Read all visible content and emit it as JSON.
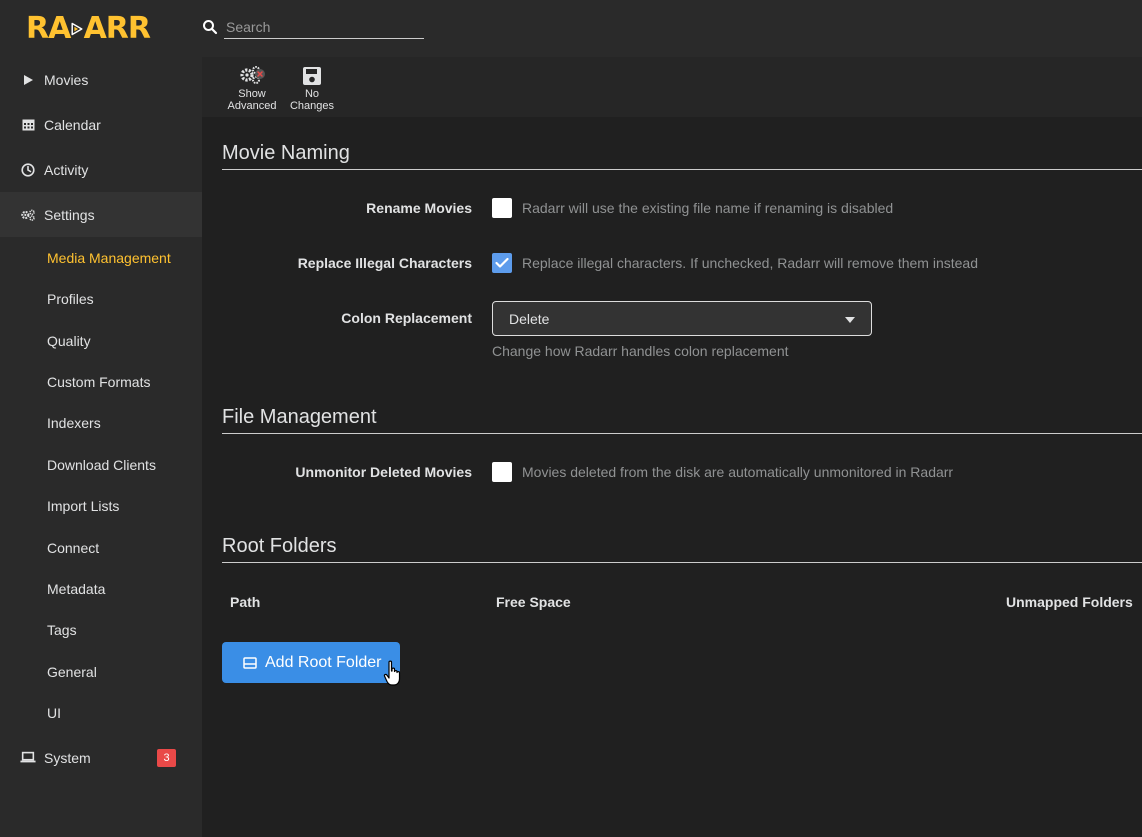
{
  "app": {
    "logo_text_left": "RA",
    "logo_text_right": "ARR",
    "brand_color": "#ffc230",
    "accent_color": "#5d9cec"
  },
  "search": {
    "placeholder": "Search",
    "value": ""
  },
  "sidebar": {
    "items": [
      {
        "label": "Movies",
        "icon": "play-icon"
      },
      {
        "label": "Calendar",
        "icon": "calendar-icon"
      },
      {
        "label": "Activity",
        "icon": "clock-icon"
      },
      {
        "label": "Settings",
        "icon": "gears-icon"
      },
      {
        "label": "System",
        "icon": "laptop-icon",
        "badge": "3"
      }
    ],
    "settings_sub": [
      "Media Management",
      "Profiles",
      "Quality",
      "Custom Formats",
      "Indexers",
      "Download Clients",
      "Import Lists",
      "Connect",
      "Metadata",
      "Tags",
      "General",
      "UI"
    ],
    "current_sub": "Media Management"
  },
  "toolbar": {
    "show_advanced": [
      "Show",
      "Advanced"
    ],
    "no_changes": [
      "No",
      "Changes"
    ]
  },
  "movie_naming": {
    "title": "Movie Naming",
    "rename_label": "Rename Movies",
    "rename_help": "Radarr will use the existing file name if renaming is disabled",
    "rename_checked": false,
    "replace_label": "Replace Illegal Characters",
    "replace_help": "Replace illegal characters. If unchecked, Radarr will remove them instead",
    "replace_checked": true,
    "colon_label": "Colon Replacement",
    "colon_value": "Delete",
    "colon_help": "Change how Radarr handles colon replacement"
  },
  "file_management": {
    "title": "File Management",
    "unmonitor_label": "Unmonitor Deleted Movies",
    "unmonitor_help": "Movies deleted from the disk are automatically unmonitored in Radarr",
    "unmonitor_checked": false
  },
  "root_folders": {
    "title": "Root Folders",
    "columns": [
      "Path",
      "Free Space",
      "Unmapped Folders"
    ],
    "add_button": "Add Root Folder"
  }
}
